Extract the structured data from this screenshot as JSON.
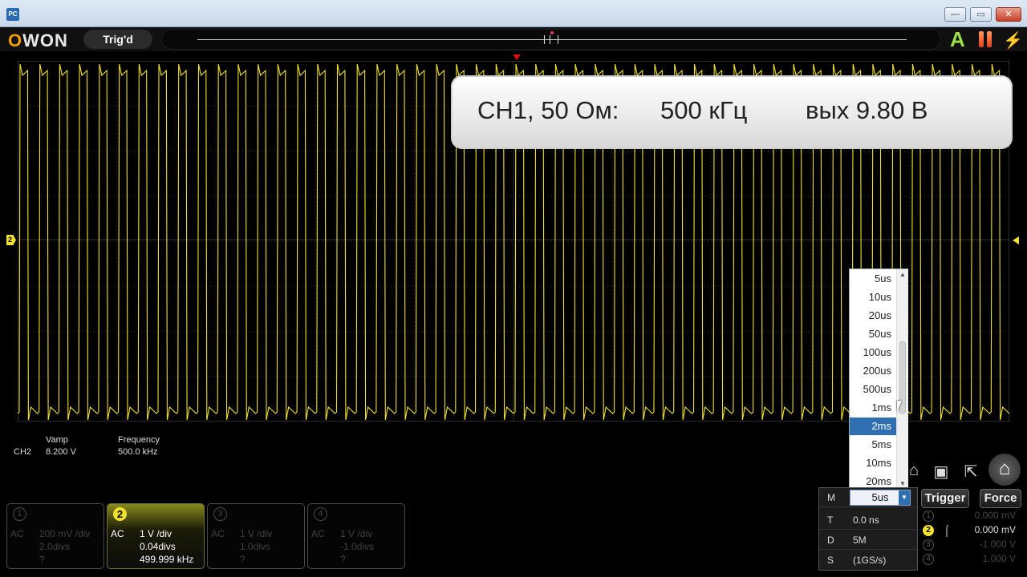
{
  "window": {
    "icon_text": "PC",
    "min": "—",
    "max": "▭",
    "close": "✕"
  },
  "toolbar": {
    "logo": "OWON",
    "trig_status": "Trig'd"
  },
  "channel_marker": "2",
  "measurement": {
    "source": "CH2",
    "amp_label": "Vamp",
    "amp_value": "8.200 V",
    "freq_label": "Frequency",
    "freq_value": "500.0 kHz"
  },
  "callout": {
    "channel": "CH1, 50 Ом:",
    "frequency": "500 кГц",
    "output": "вых 9.80 В"
  },
  "timebase_options": [
    "5us",
    "10us",
    "20us",
    "50us",
    "100us",
    "200us",
    "500us",
    "1ms",
    "2ms",
    "5ms",
    "10ms",
    "20ms"
  ],
  "timebase_selected_index": 8,
  "channels": [
    {
      "num": "1",
      "coupling": "AC",
      "scale": "200 mV /div",
      "offset": "2.0divs",
      "freq": "?"
    },
    {
      "num": "2",
      "coupling": "AC",
      "scale": "1 V /div",
      "offset": "0.04divs",
      "freq": "499.999 kHz"
    },
    {
      "num": "3",
      "coupling": "AC",
      "scale": "1 V /div",
      "offset": "1.0divs",
      "freq": "?"
    },
    {
      "num": "4",
      "coupling": "AC",
      "scale": "1 V /div",
      "offset": "-1.0divs",
      "freq": "?"
    }
  ],
  "horizontal": {
    "m_label": "M",
    "m_value": "5us",
    "t_label": "T",
    "t_value": "0.0 ns",
    "d_label": "D",
    "d_value": "5M",
    "s_label": "S",
    "s_value": "(1GS/s)"
  },
  "trigger": {
    "trigger_button": "Trigger",
    "force_button": "Force",
    "levels": [
      {
        "num": "1",
        "value": "0.000 mV"
      },
      {
        "num": "2",
        "value": "0.000 mV"
      },
      {
        "num": "3",
        "value": "-1.000 V"
      },
      {
        "num": "4",
        "value": "1.000 V"
      }
    ]
  },
  "icons": [
    "auto-icon",
    "pause-icon",
    "bolt-icon",
    "save-icon",
    "export-icon",
    "home-icon"
  ],
  "colors": {
    "trace": "#f0e030",
    "accent": "#2f6fb0",
    "trigger_marker": "#e01010"
  }
}
